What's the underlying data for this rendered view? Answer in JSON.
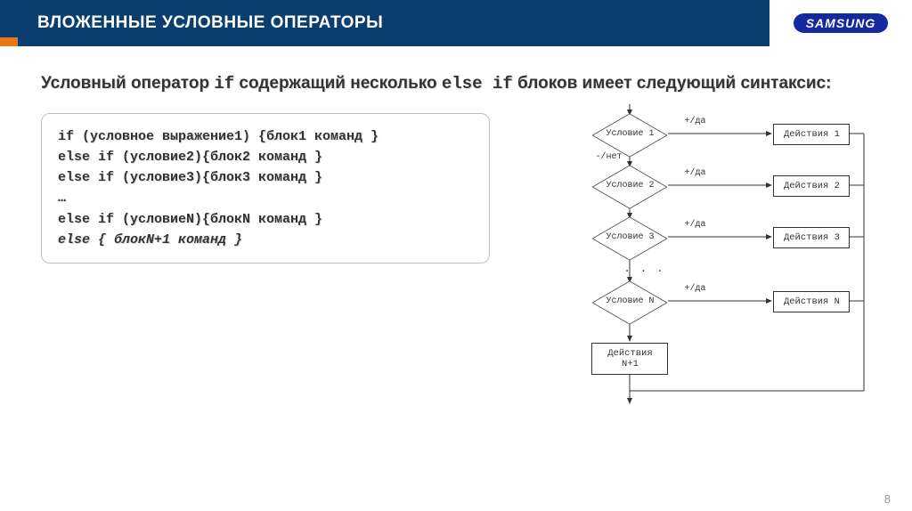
{
  "header": {
    "title": "ВЛОЖЕННЫЕ УСЛОВНЫЕ ОПЕРАТОРЫ",
    "logo": "SAMSUNG"
  },
  "intro": {
    "p1a": "Условный оператор ",
    "kw1": "if",
    "p1b": " содержащий несколько ",
    "kw2": "else if",
    "p1c": " блоков имеет следующий синтаксис:"
  },
  "code": {
    "l1": "if (условное выражение1) {блок1 команд }",
    "l2": "else if (условие2){блок2 команд }",
    "l3": "else if (условие3){блок3 команд }",
    "l4": "…",
    "l5": "else if (условиеN){блокN команд }",
    "l6": "else { блокN+1 команд }"
  },
  "flow": {
    "diamonds": [
      "Условие 1",
      "Условие 2",
      "Условие 3",
      "Условие N"
    ],
    "actions": [
      "Действия 1",
      "Действия 2",
      "Действия 3",
      "Действия N",
      "Действия N+1"
    ],
    "yes": "+/да",
    "no": "-/нет"
  },
  "page": "8"
}
